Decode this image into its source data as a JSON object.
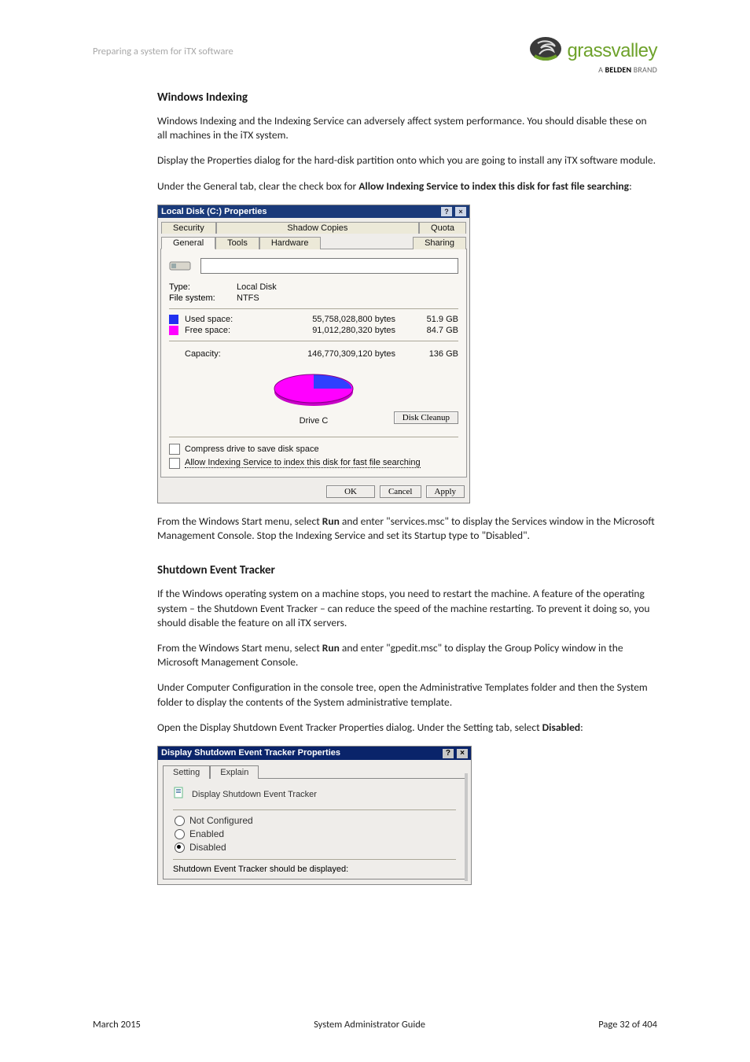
{
  "header": {
    "doc_title": "Preparing a system for iTX software",
    "logo_text": "grassvalley",
    "logo_sub": "A BELDEN BRAND",
    "logo_sub_bold": "BELDEN"
  },
  "section1": {
    "heading": "Windows Indexing",
    "p1": "Windows Indexing and the Indexing Service can adversely affect system performance. You should disable these on all machines in the iTX system.",
    "p2": "Display the Properties dialog for the hard-disk partition onto which you are going to install any iTX software module.",
    "p3_pre": "Under the General tab, clear the check box for ",
    "p3_bold": "Allow Indexing Service to index this disk for fast file searching",
    "p3_post": ":"
  },
  "dialog1": {
    "title": "Local Disk (C:) Properties",
    "help_btn": "?",
    "close_btn": "×",
    "tabs_row1": {
      "security": "Security",
      "shadow": "Shadow Copies",
      "quota": "Quota"
    },
    "tabs_row2": {
      "general": "General",
      "tools": "Tools",
      "hardware": "Hardware",
      "sharing": "Sharing"
    },
    "type_label": "Type:",
    "type_value": "Local Disk",
    "fs_label": "File system:",
    "fs_value": "NTFS",
    "used_label": "Used space:",
    "used_bytes": "55,758,028,800 bytes",
    "used_gb": "51.9 GB",
    "free_label": "Free space:",
    "free_bytes": "91,012,280,320 bytes",
    "free_gb": "84.7 GB",
    "capacity_label": "Capacity:",
    "capacity_bytes": "146,770,309,120 bytes",
    "capacity_gb": "136 GB",
    "drive_label": "Drive C",
    "cleanup_btn": "Disk Cleanup",
    "chk1": "Compress drive to save disk space",
    "chk2": "Allow Indexing Service to index this disk for fast file searching",
    "ok": "OK",
    "cancel": "Cancel",
    "apply": "Apply"
  },
  "section1b": {
    "p4_pre": "From the Windows Start menu, select ",
    "p4_bold": "Run",
    "p4_post": " and enter \"services.msc\" to display the Services window in the Microsoft Management Console. Stop the Indexing Service and set its Startup type to \"Disabled\"."
  },
  "section2": {
    "heading": "Shutdown Event Tracker",
    "p1": "If the Windows operating system on a machine stops, you need to restart the machine. A feature of the operating system – the Shutdown Event Tracker – can reduce the speed of the machine restarting. To prevent it doing so, you should disable the feature on all iTX servers.",
    "p2_pre": "From the Windows Start menu, select ",
    "p2_bold": "Run",
    "p2_post": " and enter \"gpedit.msc\" to display the Group Policy window in the Microsoft Management Console.",
    "p3": "Under Computer Configuration in the console tree, open the Administrative Templates folder and then the System folder to display the contents of the System administrative template.",
    "p4_pre": "Open the Display Shutdown Event Tracker Properties dialog. Under the Setting tab, select ",
    "p4_bold": "Disabled",
    "p4_post": ":"
  },
  "dialog2": {
    "title": "Display Shutdown Event Tracker Properties",
    "help_btn": "?",
    "close_btn": "×",
    "tab_setting": "Setting",
    "tab_explain": "Explain",
    "policy_name": "Display Shutdown Event Tracker",
    "opt_notconf": "Not Configured",
    "opt_enabled": "Enabled",
    "opt_disabled": "Disabled",
    "sub_label": "Shutdown Event Tracker should be displayed:"
  },
  "footer": {
    "left": "March 2015",
    "center": "System Administrator Guide",
    "right": "Page 32 of 404"
  }
}
